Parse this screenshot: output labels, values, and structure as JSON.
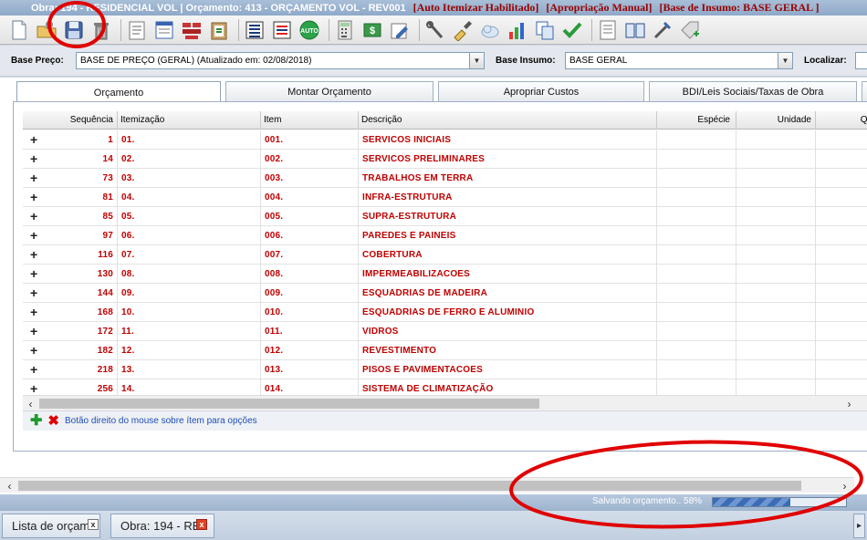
{
  "title": {
    "main": "Obra: 194 - RESIDENCIAL VOL | Orçamento: 413 - ORÇAMENTO VOL - REV001",
    "flag1": "[Auto Itemizar Habilitado]",
    "flag2": "[Apropriação Manual]",
    "flag3": "[Base de Insumo: BASE GERAL ]"
  },
  "filters": {
    "base_preco_label": "Base Preço:",
    "base_preco_value": "BASE DE PREÇO (GERAL) (Atualizado em: 02/08/2018)",
    "base_insumo_label": "Base Insumo:",
    "base_insumo_value": "BASE GERAL",
    "localizar_label": "Localizar:"
  },
  "tabs": [
    "Orçamento",
    "Montar Orçamento",
    "Apropriar Custos",
    "BDI/Leis Sociais/Taxas de Obra"
  ],
  "grid": {
    "columns": [
      "Sequência",
      "Itemização",
      "Item",
      "Descrição",
      "Espécie",
      "Unidade",
      "Quant"
    ],
    "rows": [
      {
        "seq": "1",
        "itemizacao": "01.",
        "item": "001.",
        "descricao": "SERVICOS INICIAIS"
      },
      {
        "seq": "14",
        "itemizacao": "02.",
        "item": "002.",
        "descricao": "SERVICOS PRELIMINARES"
      },
      {
        "seq": "73",
        "itemizacao": "03.",
        "item": "003.",
        "descricao": "TRABALHOS EM TERRA"
      },
      {
        "seq": "81",
        "itemizacao": "04.",
        "item": "004.",
        "descricao": "INFRA-ESTRUTURA"
      },
      {
        "seq": "85",
        "itemizacao": "05.",
        "item": "005.",
        "descricao": "SUPRA-ESTRUTURA"
      },
      {
        "seq": "97",
        "itemizacao": "06.",
        "item": "006.",
        "descricao": "PAREDES E PAINEIS"
      },
      {
        "seq": "116",
        "itemizacao": "07.",
        "item": "007.",
        "descricao": "COBERTURA"
      },
      {
        "seq": "130",
        "itemizacao": "08.",
        "item": "008.",
        "descricao": "IMPERMEABILIZACOES"
      },
      {
        "seq": "144",
        "itemizacao": "09.",
        "item": "009.",
        "descricao": "ESQUADRIAS DE MADEIRA"
      },
      {
        "seq": "168",
        "itemizacao": "10.",
        "item": "010.",
        "descricao": "ESQUADRIAS DE FERRO E ALUMINIO"
      },
      {
        "seq": "172",
        "itemizacao": "11.",
        "item": "011.",
        "descricao": "VIDROS"
      },
      {
        "seq": "182",
        "itemizacao": "12.",
        "item": "012.",
        "descricao": "REVESTIMENTO"
      },
      {
        "seq": "218",
        "itemizacao": "13.",
        "item": "013.",
        "descricao": "PISOS E PAVIMENTACOES"
      },
      {
        "seq": "256",
        "itemizacao": "14.",
        "item": "014.",
        "descricao": "SISTEMA DE CLIMATIZAÇÃO"
      }
    ],
    "hint": "Botão direito do mouse sobre ítem para opções"
  },
  "status": {
    "text": "Salvando orçamento.. 58%",
    "progress": 0.58
  },
  "bottom_tabs": [
    "Lista de orçam",
    "Obra: 194 - RE"
  ],
  "colors": {
    "row_text": "#c00000",
    "annotation_red": "#e00000",
    "title_flag": "#9a0000"
  }
}
